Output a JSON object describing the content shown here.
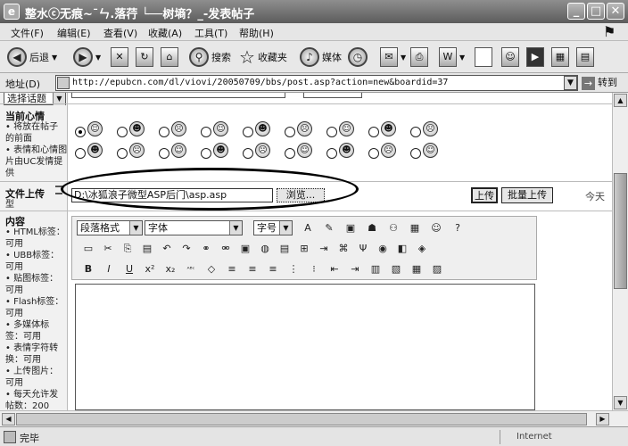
{
  "window": {
    "title": "整水ⓒ无痕~¯ㄣ.落荇 └──树墒？_-发表帖子",
    "buttons": [
      "_",
      "□",
      "✕"
    ]
  },
  "menu": [
    "文件(F)",
    "编辑(E)",
    "查看(V)",
    "收藏(A)",
    "工具(T)",
    "帮助(H)"
  ],
  "toolbar": {
    "back": "后退",
    "search": "搜索",
    "favorites": "收藏夹",
    "media": "媒体"
  },
  "address": {
    "label": "地址(D)",
    "url": "http://epubcn.com/dl/viovi/20050709/bbs/post.asp?action=new&boardid=37",
    "go": "转到"
  },
  "form": {
    "topic_select": "选择话题",
    "mood_label": "当前心情",
    "mood_notes": [
      "• 将放在帖子的前面",
      "• 表情和心情图片由UC发情提供"
    ],
    "upload_label": "文件上传",
    "upload_label2": "型",
    "upload_path": "D:\\冰狐浪子微型ASP后门\\asp.asp",
    "browse": "浏览...",
    "upload": "上传",
    "batch_upload": "批量上传",
    "today_text": "今天",
    "content_label": "内容",
    "content_notes": [
      "• HTML标签：可用",
      "• UBB标签：可用",
      "• 贴图标签：可用",
      "• Flash标签：可用",
      "• 多媒体标签：可用",
      "• 表情字符转换：可用",
      "• 上传图片：可用",
      "• 每天允许发帖数：200"
    ]
  },
  "editor": {
    "paragraph": "段落格式",
    "font": "字体",
    "size": "字号"
  },
  "status": {
    "text": "完毕",
    "zone": "Internet"
  }
}
